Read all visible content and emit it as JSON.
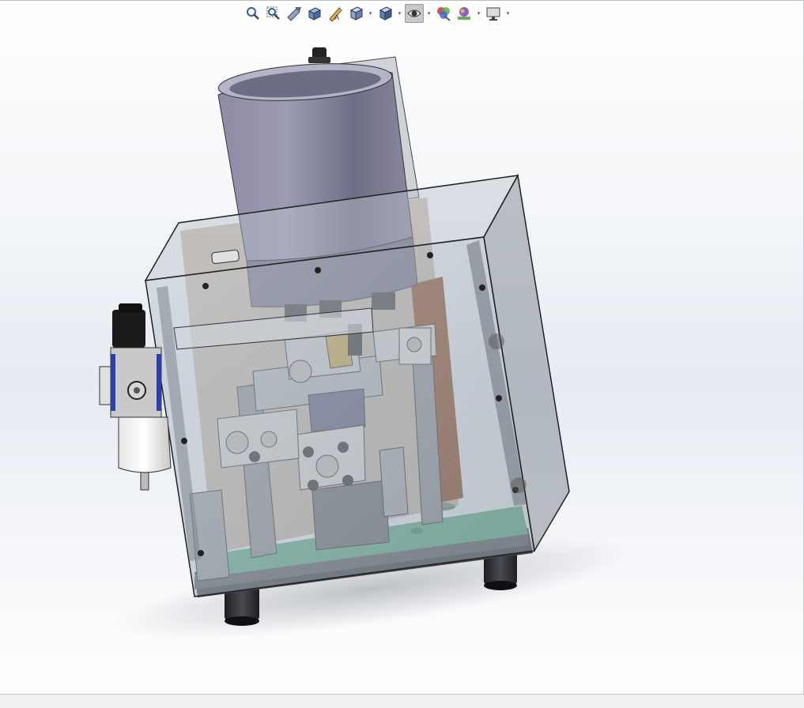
{
  "window": {
    "title": ""
  },
  "heads_up_toolbar": {
    "buttons": [
      {
        "id": "zoom-to-fit",
        "icon": "zoom-to-fit-icon"
      },
      {
        "id": "zoom-to-area",
        "icon": "zoom-to-area-icon"
      },
      {
        "id": "previous-view",
        "icon": "previous-view-icon"
      },
      {
        "id": "section-view",
        "icon": "section-view-icon"
      },
      {
        "id": "dynamic-annotation-views",
        "icon": "annotation-views-icon"
      },
      {
        "id": "view-orientation",
        "icon": "view-orientation-icon",
        "dropdown": true
      },
      {
        "id": "display-style",
        "icon": "display-style-icon",
        "dropdown": true
      },
      {
        "id": "hide-show-items",
        "icon": "hide-show-eye-icon",
        "dropdown": true,
        "active": true
      },
      {
        "id": "edit-appearance",
        "icon": "edit-appearance-icon"
      },
      {
        "id": "apply-scene",
        "icon": "apply-scene-icon",
        "dropdown": true
      },
      {
        "id": "view-settings",
        "icon": "view-settings-monitor-icon",
        "dropdown": true
      }
    ]
  },
  "colors": {
    "accent_active": "#c8c8c8",
    "hopper": "#7f7e96",
    "base_plate": "#5fae8c",
    "enclosure_glass": "#aab3bd",
    "regulator_blue": "#2d3fa8"
  },
  "status_bar": {
    "text": ""
  }
}
